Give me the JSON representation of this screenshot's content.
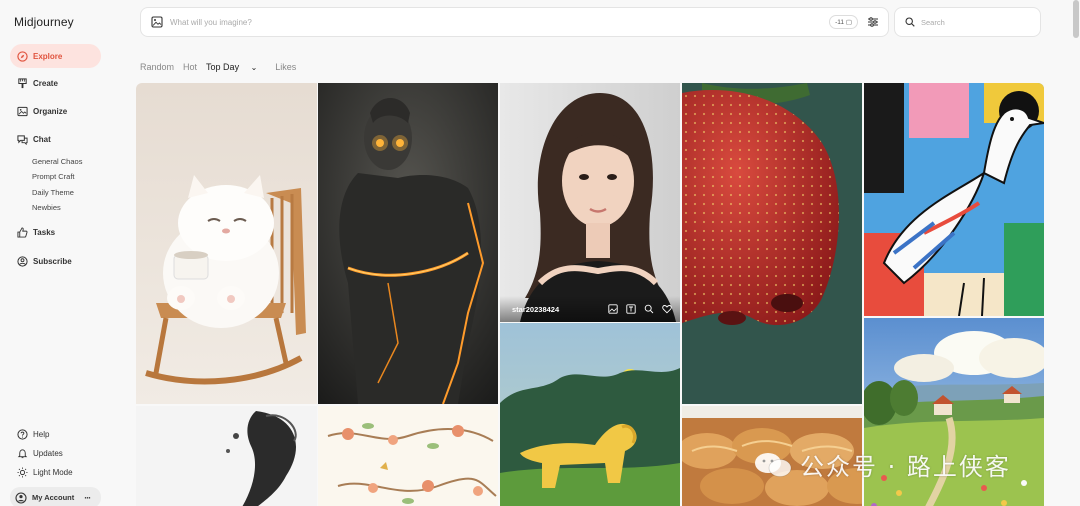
{
  "app": {
    "title": "Midjourney"
  },
  "sidebar": {
    "nav": [
      {
        "label": "Explore",
        "icon": "compass-icon"
      },
      {
        "label": "Create",
        "icon": "brush-icon"
      },
      {
        "label": "Organize",
        "icon": "image-icon"
      },
      {
        "label": "Chat",
        "icon": "chat-icon"
      }
    ],
    "chat_rooms": [
      "General Chaos",
      "Prompt Craft",
      "Daily Theme",
      "Newbies"
    ],
    "tasks": {
      "label": "Tasks",
      "icon": "thumbs-up-icon"
    },
    "subscribe": {
      "label": "Subscribe",
      "icon": "subscribe-icon"
    },
    "footer": [
      {
        "label": "Help",
        "icon": "help-icon"
      },
      {
        "label": "Updates",
        "icon": "bell-icon"
      },
      {
        "label": "Light Mode",
        "icon": "sun-icon"
      }
    ],
    "account": {
      "label": "My Account",
      "menu": "···"
    }
  },
  "prompt": {
    "placeholder": "What will you imagine?",
    "ratio": "-11",
    "ratio_glyph": "▢"
  },
  "search": {
    "placeholder": "Search"
  },
  "filters": {
    "tabs": [
      "Random",
      "Hot",
      "Top Day",
      "Likes"
    ],
    "active": "Top Day",
    "dropdown_glyph": "⌄"
  },
  "gallery": {
    "hover_user": "star20238424"
  },
  "watermark": {
    "text": "公众号 · 路上侠客"
  },
  "colors": {
    "accent": "#e0533e",
    "accent_bg": "#fde3df"
  }
}
